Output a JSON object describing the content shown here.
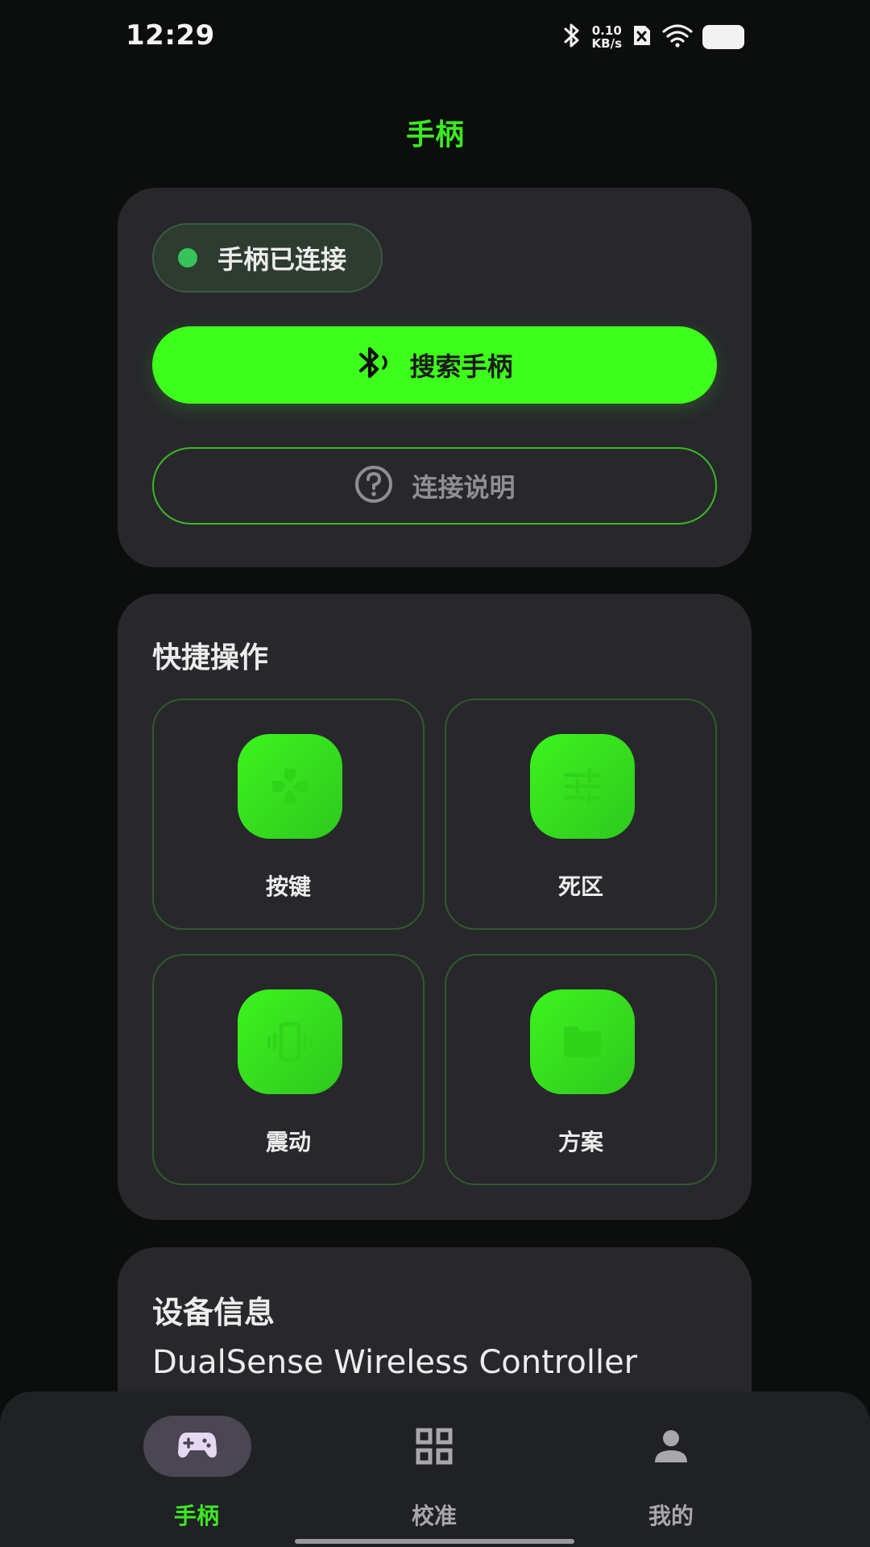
{
  "status_bar": {
    "time": "12:29",
    "net_speed_value": "0.10",
    "net_speed_unit": "KB/s",
    "icons": [
      "bluetooth-icon",
      "sim-off-icon",
      "wifi-icon",
      "battery-icon"
    ]
  },
  "page": {
    "title": "手柄"
  },
  "connection": {
    "status_text": "手柄已连接",
    "search_label": "搜索手柄",
    "help_label": "连接说明"
  },
  "quick_actions": {
    "title": "快捷操作",
    "items": [
      {
        "label": "按键",
        "icon": "dpad-icon"
      },
      {
        "label": "死区",
        "icon": "sliders-icon"
      },
      {
        "label": "震动",
        "icon": "vibration-icon"
      },
      {
        "label": "方案",
        "icon": "folder-icon"
      }
    ]
  },
  "device": {
    "title": "设备信息",
    "name": "DualSense Wireless Controller"
  },
  "bottom_nav": {
    "items": [
      {
        "label": "手柄",
        "icon": "gamepad-icon",
        "active": true
      },
      {
        "label": "校准",
        "icon": "grid-icon",
        "active": false
      },
      {
        "label": "我的",
        "icon": "person-icon",
        "active": false
      }
    ]
  },
  "colors": {
    "accent": "#3dff1b",
    "background": "#0c0d0d",
    "card": "#28282c",
    "connected_dot": "#35c35a",
    "nav_active": "#3bea22",
    "nav_inactive": "#a8a8ac"
  }
}
